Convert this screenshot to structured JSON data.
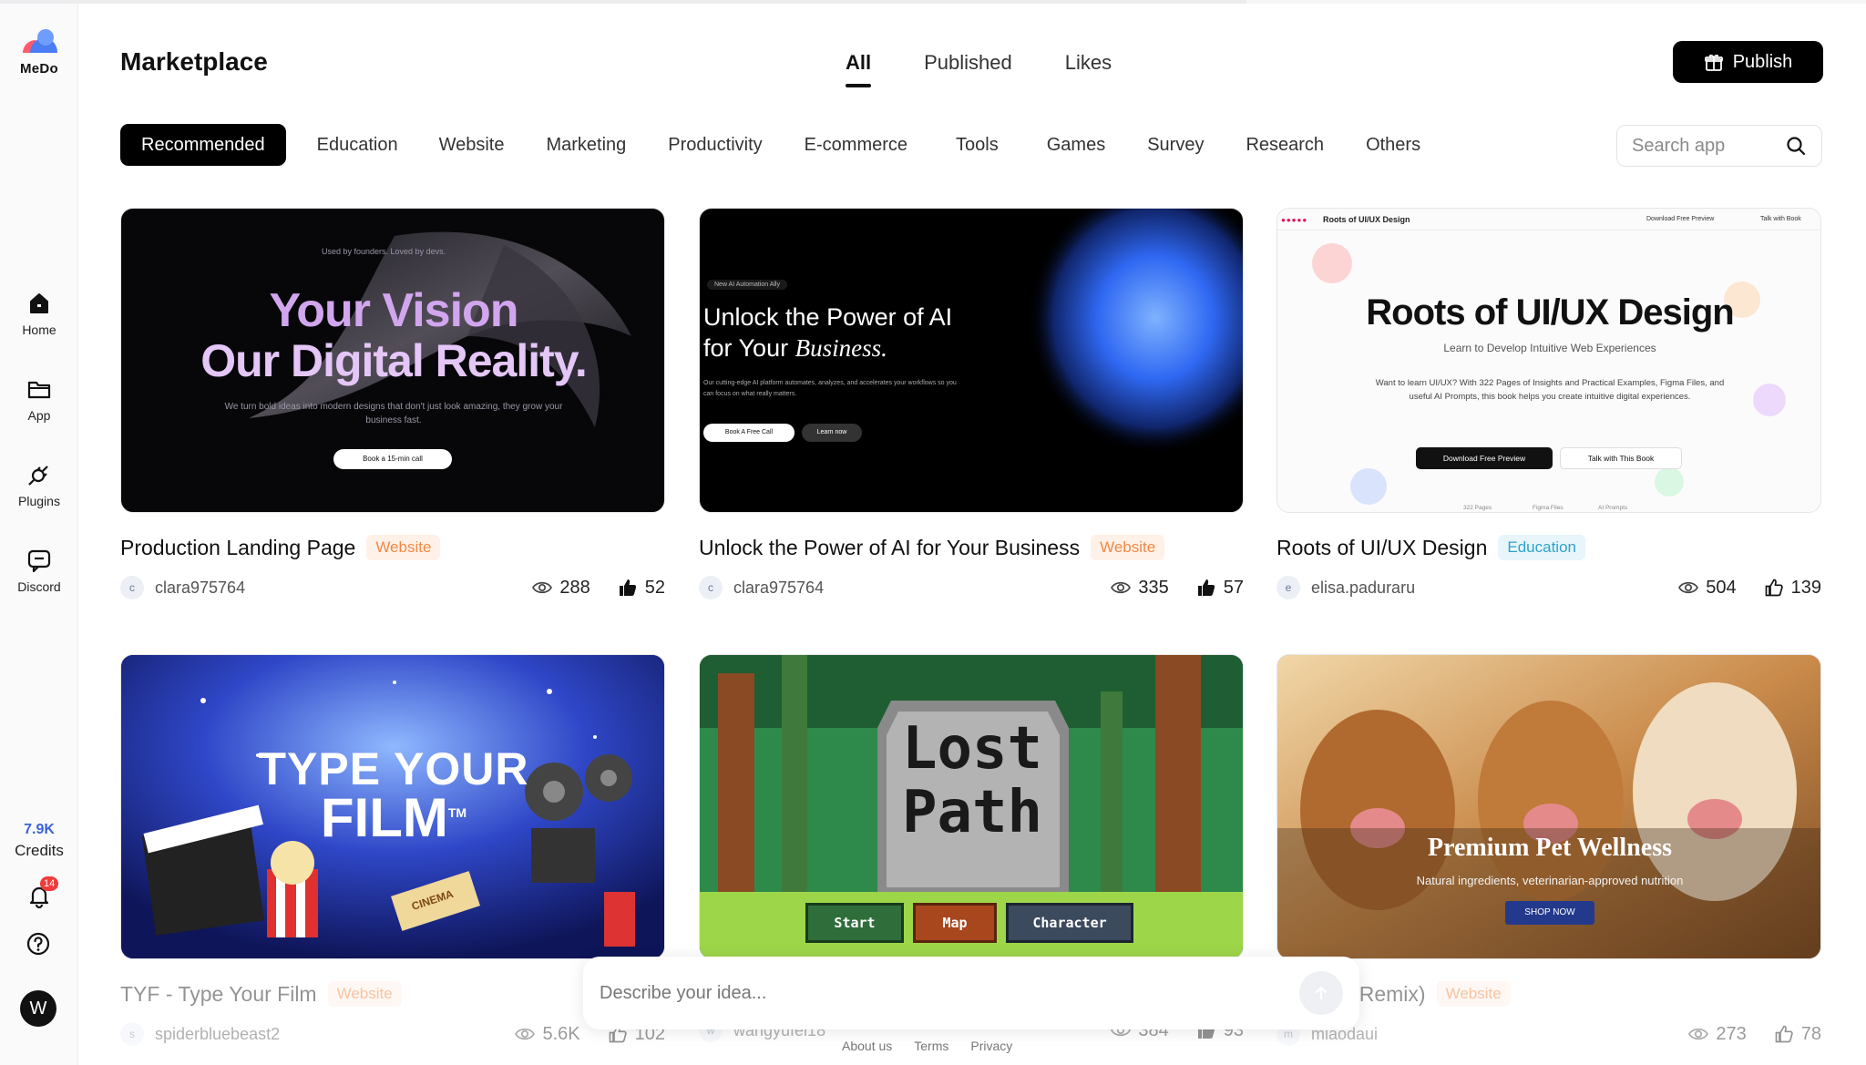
{
  "sidebar": {
    "logo_text": "MeDo",
    "items": [
      {
        "label": "Home",
        "icon": "home-icon"
      },
      {
        "label": "App",
        "icon": "folder-icon"
      },
      {
        "label": "Plugins",
        "icon": "plug-icon"
      },
      {
        "label": "Discord",
        "icon": "chat-icon"
      }
    ],
    "credits_value": "7.9K",
    "credits_label": "Credits",
    "notification_count": "14",
    "avatar_initial": "W"
  },
  "header": {
    "title": "Marketplace",
    "tabs": [
      "All",
      "Published",
      "Likes"
    ],
    "active_tab": "All",
    "publish_label": "Publish"
  },
  "categories": [
    "Recommended",
    "Education",
    "Website",
    "Marketing",
    "Productivity",
    "E-commerce",
    "Tools",
    "Games",
    "Survey",
    "Research",
    "Others"
  ],
  "search": {
    "placeholder": "Search app"
  },
  "cards": [
    {
      "title": "Production Landing Page",
      "tag": "Website",
      "user": "clara975764",
      "user_initial": "c",
      "views": "288",
      "likes": "52",
      "thumb": {
        "line1": "Your Vision",
        "line2": "Our Digital Reality.",
        "small_top": "Used by founders. Loved by devs.",
        "desc": "We turn bold ideas into modern designs that don't just look amazing, they grow your business fast.",
        "cta": "Book a 15-min call"
      }
    },
    {
      "title": "Unlock the Power of AI for Your Business",
      "tag": "Website",
      "user": "clara975764",
      "user_initial": "c",
      "views": "335",
      "likes": "57",
      "thumb": {
        "badge": "New AI Automation Ally",
        "line1": "Unlock the Power of AI",
        "line2a": "for Your ",
        "line2b": "Business.",
        "desc": "Our cutting-edge AI platform automates, analyzes, and accelerates your workflows so you can focus on what really matters.",
        "btn1": "Book A Free Call",
        "btn2": "Learn now"
      }
    },
    {
      "title": "Roots of UI/UX Design",
      "tag": "Education",
      "user": "elisa.paduraru",
      "user_initial": "e",
      "views": "504",
      "likes": "139",
      "thumb": {
        "nav_title": "Roots of UI/UX Design",
        "nav_link1": "Download Free Preview",
        "nav_link2": "Talk with Book",
        "heading": "Roots of UI/UX Design",
        "sub": "Learn to Develop Intuitive Web Experiences",
        "desc": "Want to learn UI/UX? With 322 Pages of Insights and Practical Examples, Figma Files, and useful AI Prompts, this book helps you create intuitive digital experiences.",
        "btn1": "Download Free Preview",
        "btn2": "Talk with This Book",
        "foot1": "322 Pages",
        "foot2": "Figma Files",
        "foot3": "AI Prompts"
      }
    },
    {
      "title": "TYF - Type Your Film",
      "tag": "Website",
      "user": "spiderbluebeast2",
      "user_initial": "s",
      "views": "5.6K",
      "likes": "102",
      "thumb": {
        "line1": "TYPE YOUR",
        "line2": "FILM",
        "tm": "TM",
        "ticket": "CINEMA"
      }
    },
    {
      "title": "",
      "tag": "",
      "user": "wangyufei18",
      "user_initial": "w",
      "views": "384",
      "likes": "93",
      "thumb": {
        "line1": "Lost",
        "line2": "Path",
        "btn1": "Start",
        "btn2": "Map",
        "btn3": "Character"
      }
    },
    {
      "title": "armony (Remix)",
      "tag": "Website",
      "user": "miaodaui",
      "user_initial": "m",
      "views": "273",
      "likes": "78",
      "thumb": {
        "heading": "Premium Pet Wellness",
        "sub": "Natural ingredients, veterinarian-approved nutrition",
        "cta": "SHOP NOW"
      }
    }
  ],
  "prompt": {
    "placeholder": "Describe your idea..."
  },
  "footer": [
    "About us",
    "Terms",
    "Privacy"
  ],
  "colors": {
    "accent_black": "#000000",
    "website_tag": "#f08a46",
    "education_tag": "#2fa3c9",
    "credits": "#3b64d6",
    "badge": "#ef3b3b"
  }
}
